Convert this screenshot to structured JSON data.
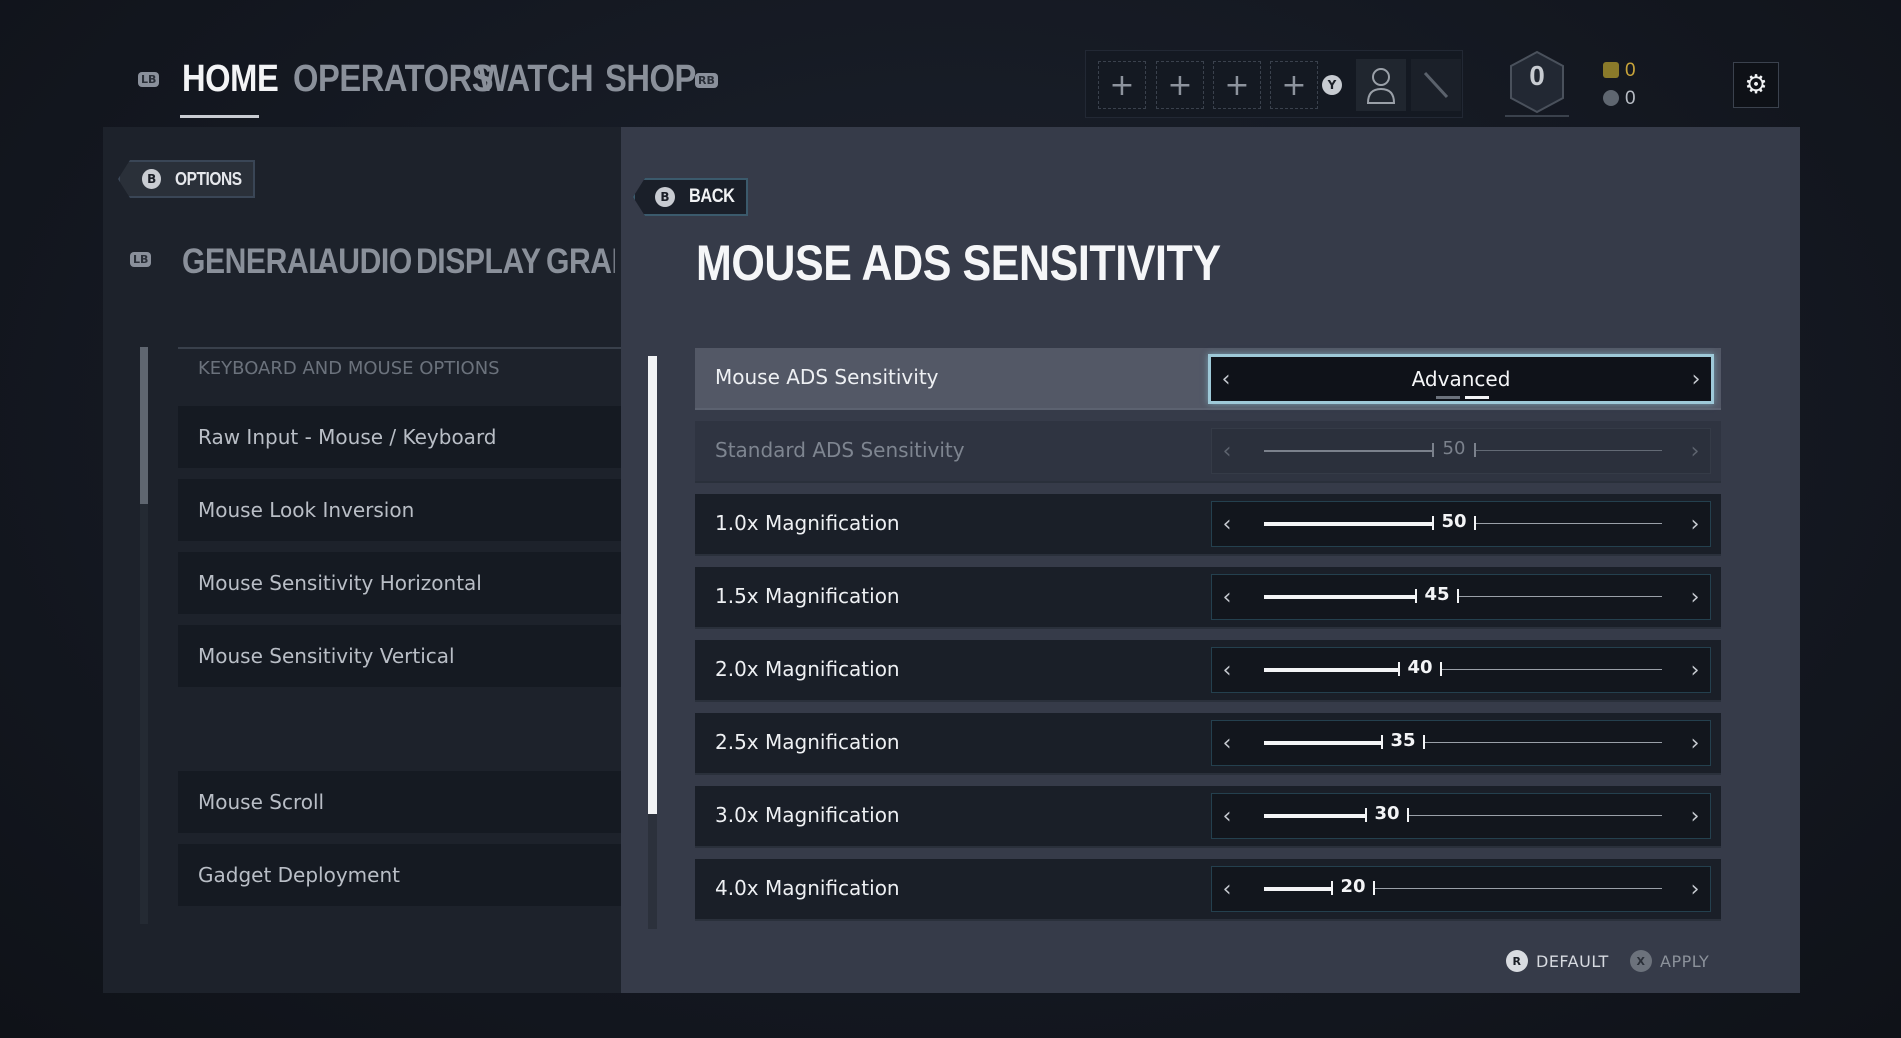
{
  "topnav": {
    "lb_badge": "LB",
    "rb_badge": "RB",
    "tabs": [
      {
        "label": "HOME",
        "active": true
      },
      {
        "label": "OPERATORS",
        "active": false
      },
      {
        "label": "WATCH",
        "active": false
      },
      {
        "label": "SHOP",
        "active": false
      }
    ],
    "squad_slot_icon": "+",
    "squad_invite_button": "Y",
    "rank_value": "0",
    "renown": "0",
    "r6_credits": "0",
    "settings_icon": "⚙"
  },
  "options_panel": {
    "header_button_key": "B",
    "header_label": "OPTIONS",
    "lb_badge": "LB",
    "subtabs": [
      "GENERAL",
      "AUDIO",
      "DISPLAY",
      "GRAPH"
    ],
    "section_title": "KEYBOARD AND MOUSE OPTIONS",
    "items": [
      "Raw Input - Mouse / Keyboard",
      "Mouse Look Inversion",
      "Mouse Sensitivity Horizontal",
      "Mouse Sensitivity Vertical",
      "Mouse Scroll",
      "Gadget Deployment"
    ]
  },
  "sensitivity_panel": {
    "back_key": "B",
    "back_label": "BACK",
    "title": "MOUSE ADS SENSITIVITY",
    "mode_row": {
      "label": "Mouse ADS Sensitivity",
      "value": "Advanced",
      "page_index": 1,
      "page_count": 2
    },
    "sliders": [
      {
        "label": "Standard ADS Sensitivity",
        "value": 50,
        "display": "50",
        "disabled": true
      },
      {
        "label": "1.0x Magnification",
        "value": 50,
        "display": "50",
        "disabled": false
      },
      {
        "label": "1.5x Magnification",
        "value": 45,
        "display": "45",
        "disabled": false
      },
      {
        "label": "2.0x Magnification",
        "value": 40,
        "display": "40",
        "disabled": false
      },
      {
        "label": "2.5x Magnification",
        "value": 35,
        "display": "35",
        "disabled": false
      },
      {
        "label": "3.0x Magnification",
        "value": 30,
        "display": "30",
        "disabled": false
      },
      {
        "label": "4.0x Magnification",
        "value": 20,
        "display": "20",
        "disabled": false
      }
    ],
    "slider_max": 100,
    "arrow_left": "‹",
    "arrow_right": "›"
  },
  "footer": {
    "default_key": "R",
    "default_label": "DEFAULT",
    "apply_key": "X",
    "apply_label": "APPLY"
  },
  "colors": {
    "accent_border": "#9ec9d8",
    "rank_currency": "#c8a43a"
  }
}
